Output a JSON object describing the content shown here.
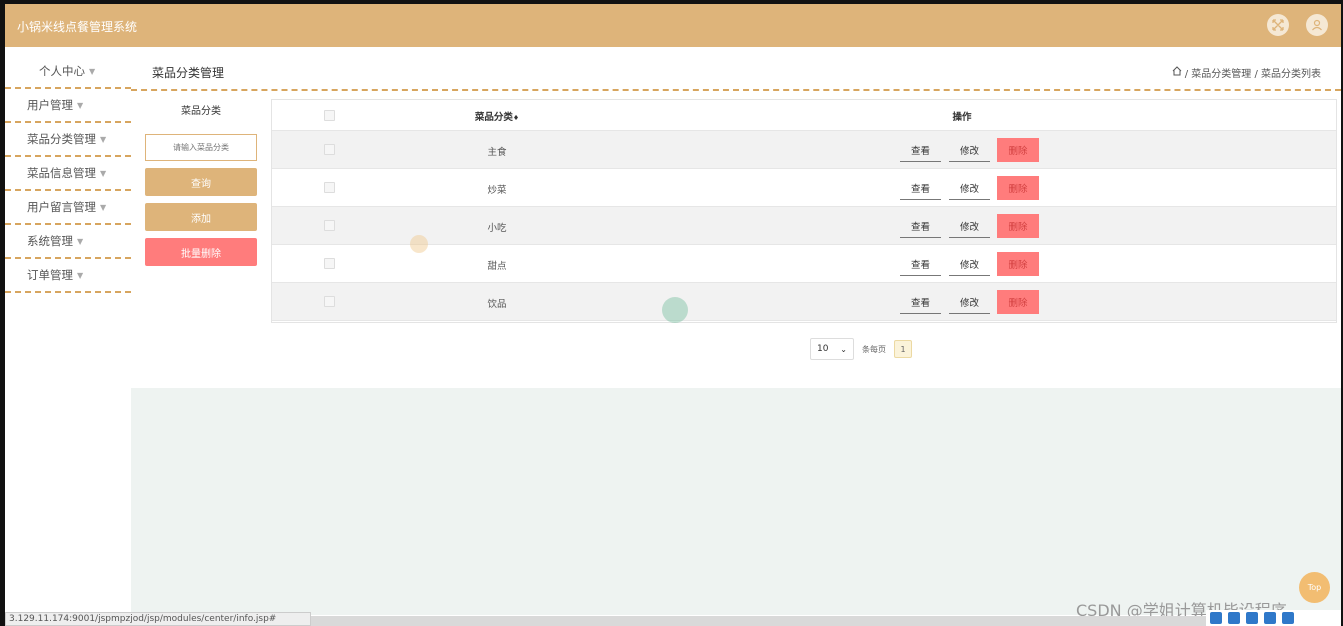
{
  "app": {
    "title": "小锅米线点餐管理系统"
  },
  "sidebar": {
    "items": [
      {
        "label": "个人中心"
      },
      {
        "label": "用户管理"
      },
      {
        "label": "菜品分类管理"
      },
      {
        "label": "菜品信息管理"
      },
      {
        "label": "用户留言管理"
      },
      {
        "label": "系统管理"
      },
      {
        "label": "订单管理"
      }
    ]
  },
  "page": {
    "title": "菜品分类管理",
    "breadcrumb": "/ 菜品分类管理 / 菜品分类列表"
  },
  "search": {
    "label": "菜品分类",
    "placeholder": "请输入菜品分类",
    "query_button": "查询",
    "add_button": "添加",
    "batch_delete_button": "批量删除"
  },
  "table": {
    "headers": {
      "name": "菜品分类",
      "sort_mark": "♦",
      "ops": "操作"
    },
    "rows": [
      {
        "name": "主食"
      },
      {
        "name": "炒菜"
      },
      {
        "name": "小吃"
      },
      {
        "name": "甜点"
      },
      {
        "name": "饮品"
      }
    ],
    "actions": {
      "view": "查看",
      "edit": "修改",
      "delete": "删除"
    }
  },
  "pagination": {
    "page_size": "10",
    "per_page_label": "条每页",
    "current_page": "1"
  },
  "misc": {
    "top_button": "Top",
    "status_url": "3.129.11.174:9001/jspmpzjod/jsp/modules/center/info.jsp#",
    "watermark": "CSDN @学姐计算机毕设程序"
  },
  "colors": {
    "accent": "#deb47a",
    "danger": "#ff7c7c",
    "panel": "#eef3f1"
  }
}
